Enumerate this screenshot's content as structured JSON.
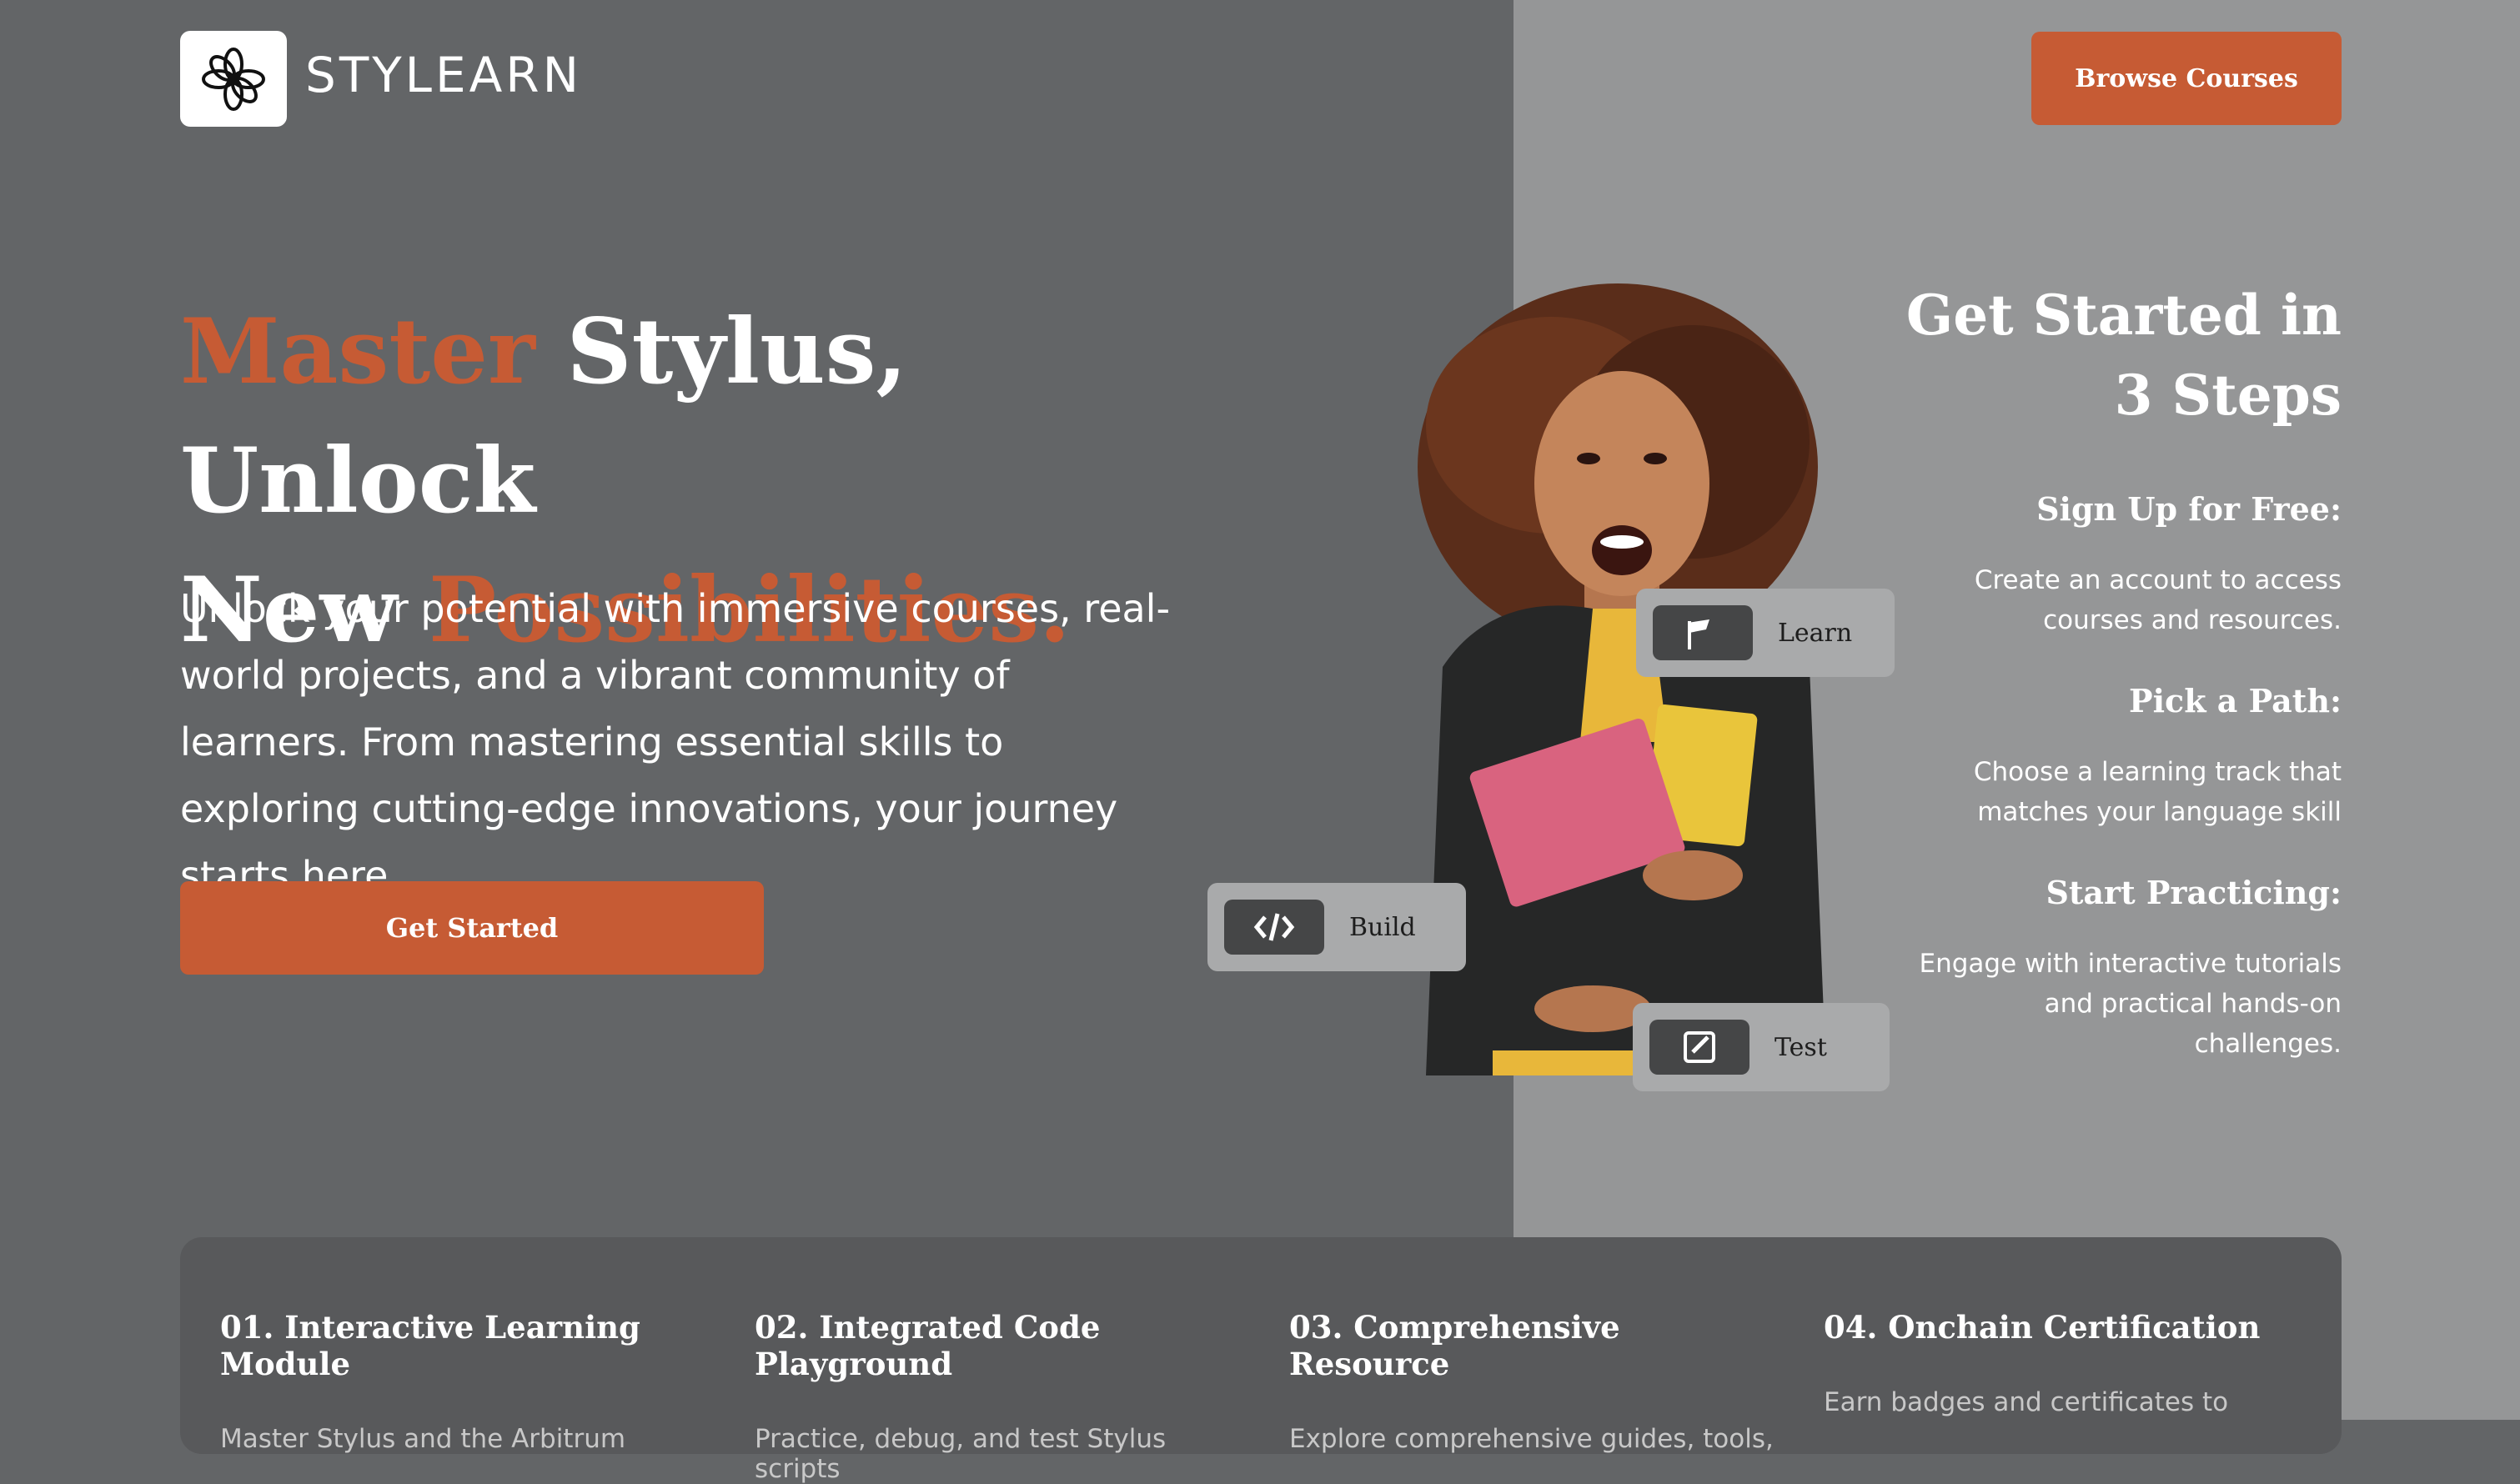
{
  "brand": {
    "name": "STYLEARN"
  },
  "header": {
    "browse_label": "Browse Courses"
  },
  "hero": {
    "title_part1": "Master",
    "title_part2": " Stylus, Unlock",
    "title_part3": "New ",
    "title_part4": "Possibilities.",
    "intro": "Unlock your potential with immersive courses, real-world projects, and a vibrant community of learners. From mastering essential skills to exploring cutting-edge innovations, your journey starts here.",
    "cta_label": "Get Started"
  },
  "chips": {
    "learn": "Learn",
    "build": "Build",
    "test": "Test"
  },
  "steps": {
    "title_line1": "Get Started in",
    "title_line2": "3 Steps",
    "items": [
      {
        "heading": "Sign Up for Free:",
        "text": "Create an account to access courses and resources."
      },
      {
        "heading": "Pick a Path:",
        "text": "Choose a learning track that matches your language skill"
      },
      {
        "heading": "Start Practicing:",
        "text": "Engage with interactive tutorials and practical hands-on challenges."
      }
    ]
  },
  "features": [
    {
      "title": "01. Interactive Learning Module",
      "text": "Master Stylus and the Arbitrum"
    },
    {
      "title": "02. Integrated Code Playground",
      "text": "Practice, debug, and test Stylus scripts"
    },
    {
      "title": "03. Comprehensive Resource",
      "text": "Explore comprehensive guides, tools,"
    },
    {
      "title": "04. Onchain Certification",
      "text": "Earn badges and certificates to"
    }
  ],
  "colors": {
    "accent": "#c65b34",
    "left_bg": "#636567",
    "right_bg": "#959697"
  }
}
